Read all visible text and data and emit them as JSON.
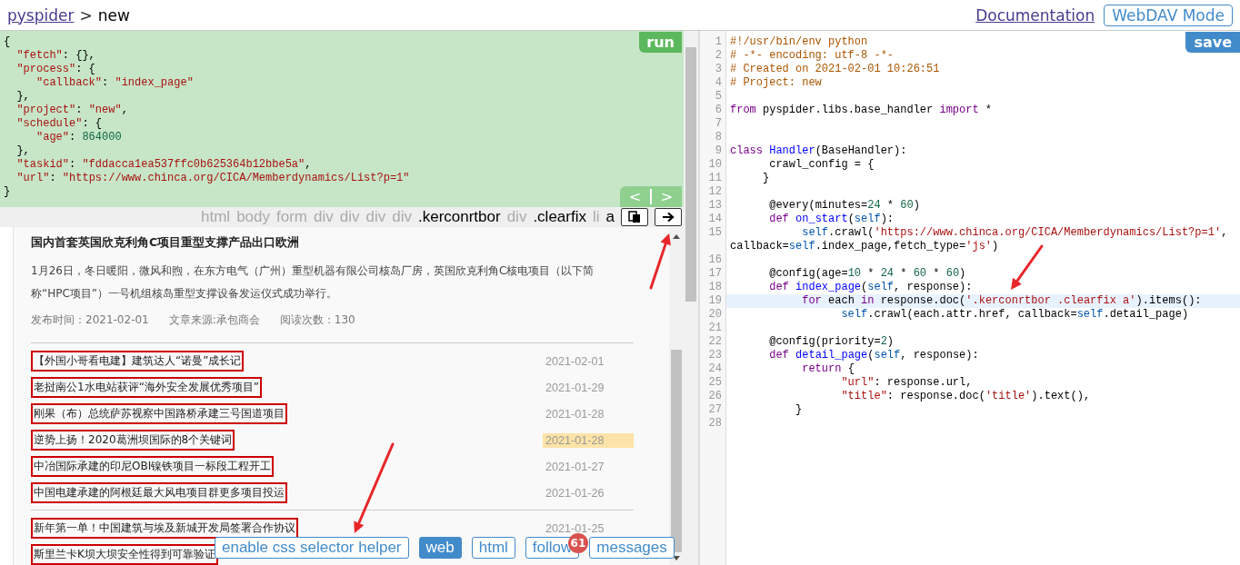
{
  "header": {
    "project_link": "pyspider",
    "separator": ">",
    "project": "new",
    "documentation_link": "Documentation",
    "webdav_button": "WebDAV Mode"
  },
  "task": {
    "run_button": "run",
    "nav_buttons": [
      "<",
      ">"
    ],
    "lines": [
      [
        {
          "kind": "plain",
          "text": "{"
        }
      ],
      [
        {
          "kind": "string",
          "text": "  \"fetch\""
        },
        {
          "kind": "plain",
          "text": ": {},"
        }
      ],
      [
        {
          "kind": "string",
          "text": "  \"process\""
        },
        {
          "kind": "plain",
          "text": ": {"
        }
      ],
      [
        {
          "kind": "string",
          "text": "     \"callback\""
        },
        {
          "kind": "plain",
          "text": ": "
        },
        {
          "kind": "string",
          "text": "\"index_page\""
        }
      ],
      [
        {
          "kind": "plain",
          "text": "  },"
        }
      ],
      [
        {
          "kind": "string",
          "text": "  \"project\""
        },
        {
          "kind": "plain",
          "text": ": "
        },
        {
          "kind": "string",
          "text": "\"new\""
        },
        {
          "kind": "plain",
          "text": ","
        }
      ],
      [
        {
          "kind": "string",
          "text": "  \"schedule\""
        },
        {
          "kind": "plain",
          "text": ": {"
        }
      ],
      [
        {
          "kind": "string",
          "text": "     \"age\""
        },
        {
          "kind": "plain",
          "text": ": "
        },
        {
          "kind": "number",
          "text": "864000"
        }
      ],
      [
        {
          "kind": "plain",
          "text": "  },"
        }
      ],
      [
        {
          "kind": "string",
          "text": "  \"taskid\""
        },
        {
          "kind": "plain",
          "text": ": "
        },
        {
          "kind": "string",
          "text": "\"fddacca1ea537ffc0b625364b12bbe5a\""
        },
        {
          "kind": "plain",
          "text": ","
        }
      ],
      [
        {
          "kind": "string",
          "text": "  \"url\""
        },
        {
          "kind": "plain",
          "text": ": "
        },
        {
          "kind": "string",
          "text": "\"https://www.chinca.org/CICA/Memberdynamics/List?p=1\""
        }
      ],
      [
        {
          "kind": "plain",
          "text": "}"
        }
      ]
    ]
  },
  "css_path": {
    "items": [
      {
        "text": "html",
        "selected": false
      },
      {
        "text": "body",
        "selected": false
      },
      {
        "text": "form",
        "selected": false
      },
      {
        "text": "div",
        "selected": false
      },
      {
        "text": "div",
        "selected": false
      },
      {
        "text": "div",
        "selected": false
      },
      {
        "text": "div",
        "selected": false
      },
      {
        "text": ".kerconrtbor",
        "selected": true
      },
      {
        "text": "div",
        "selected": false
      },
      {
        "text": ".clearfix",
        "selected": true
      },
      {
        "text": "li",
        "selected": false
      },
      {
        "text": "a",
        "selected": true
      }
    ],
    "arrow_button": {
      "annotated": true
    }
  },
  "preview": {
    "article": {
      "title": "国内首套英国欣克利角C项目重型支撑产品出口欧洲",
      "summary": "1月26日，冬日暖阳，微风和煦，在东方电气（广州）重型机器有限公司核岛厂房，英国欣克利角C核电项目（以下简称“HPC项目”）一号机组核岛重型支撑设备发运仪式成功举行。",
      "meta": [
        "发布时间：2021-02-01",
        "文章来源:承包商会",
        "阅读次数：130"
      ]
    },
    "news_groups": [
      [
        {
          "title": "【外国小哥看电建】建筑达人“诺曼”成长记",
          "date": "2021-02-01",
          "selected": true,
          "highlighted": false
        },
        {
          "title": "老挝南公1水电站获评“海外安全发展优秀项目”",
          "date": "2021-01-29",
          "selected": true,
          "highlighted": false
        },
        {
          "title": "刚果（布）总统萨苏视察中国路桥承建三号国道项目",
          "date": "2021-01-28",
          "selected": true,
          "highlighted": false
        },
        {
          "title": "逆势上扬！2020葛洲坝国际的8个关键词",
          "date": "2021-01-28",
          "selected": true,
          "highlighted": true
        },
        {
          "title": "中冶国际承建的印尼OBI镍铁项目一标段工程开工",
          "date": "2021-01-27",
          "selected": true,
          "highlighted": false
        },
        {
          "title": "中国电建承建的阿根廷最大风电项目群更多项目投运",
          "date": "2021-01-26",
          "selected": true,
          "highlighted": false
        }
      ],
      [
        {
          "title": "新年第一单！中国建筑与埃及新城开发局签署合作协议",
          "date": "2021-01-25",
          "selected": true,
          "highlighted": false
        },
        {
          "title": "斯里兰卡K坝大坝安全性得到可靠验证",
          "selected": true
        }
      ]
    ],
    "helper_button": {
      "label": "enable css selector helper",
      "annotated": true
    },
    "tabs": [
      {
        "label": "web",
        "selected": true
      },
      {
        "label": "html",
        "selected": false
      },
      {
        "label": "follow",
        "selected": false,
        "badge": "61"
      },
      {
        "label": "messages",
        "selected": false
      }
    ]
  },
  "editor": {
    "save_button": "save",
    "lines": [
      {
        "number": "1",
        "tokens": [
          {
            "kind": "comment",
            "text": "#!/usr/bin/env python"
          }
        ]
      },
      {
        "number": "2",
        "tokens": [
          {
            "kind": "comment",
            "text": "# -*- encoding: utf-8 -*-"
          }
        ]
      },
      {
        "number": "3",
        "tokens": [
          {
            "kind": "comment",
            "text": "# Created on 2021-02-01 10:26:51"
          }
        ]
      },
      {
        "number": "4",
        "tokens": [
          {
            "kind": "comment",
            "text": "# Project: new"
          }
        ]
      },
      {
        "number": "5"
      },
      {
        "number": "6",
        "tokens": [
          {
            "kind": "keyword",
            "text": "from"
          },
          {
            "kind": "plain",
            "text": " pyspider.libs.base_handler "
          },
          {
            "kind": "keyword",
            "text": "import"
          },
          {
            "kind": "plain",
            "text": " *"
          }
        ]
      },
      {
        "number": "7"
      },
      {
        "number": "8"
      },
      {
        "number": "9",
        "tokens": [
          {
            "kind": "keyword",
            "text": "class"
          },
          {
            "kind": "definition",
            "text": " Handler"
          },
          {
            "kind": "plain",
            "text": "(BaseHandler):"
          }
        ]
      },
      {
        "number": "10",
        "tokens": [
          {
            "kind": "plain",
            "text": "      crawl_config = {"
          }
        ]
      },
      {
        "number": "11",
        "tokens": [
          {
            "kind": "plain",
            "text": "     }"
          }
        ]
      },
      {
        "number": "12"
      },
      {
        "number": "13",
        "tokens": [
          {
            "kind": "plain",
            "text": "      @every(minutes="
          },
          {
            "kind": "number",
            "text": "24"
          },
          {
            "kind": "plain",
            "text": " * "
          },
          {
            "kind": "number",
            "text": "60"
          },
          {
            "kind": "plain",
            "text": ")"
          }
        ]
      },
      {
        "number": "14",
        "tokens": [
          {
            "kind": "keyword",
            "text": "      def"
          },
          {
            "kind": "definition",
            "text": " on_start"
          },
          {
            "kind": "plain",
            "text": "("
          },
          {
            "kind": "variable",
            "text": "self"
          },
          {
            "kind": "plain",
            "text": "):"
          }
        ]
      },
      {
        "number": "15",
        "tokens": [
          {
            "kind": "variable",
            "text": "           self"
          },
          {
            "kind": "plain",
            "text": ".crawl("
          },
          {
            "kind": "string",
            "text": "'https://www.chinca.org/CICA/Memberdynamics/List?p=1'"
          },
          {
            "kind": "plain",
            "text": ", callback="
          },
          {
            "kind": "variable",
            "text": "self"
          },
          {
            "kind": "plain",
            "text": ".index_page,fetch_type="
          },
          {
            "kind": "string",
            "text": "'js'"
          },
          {
            "kind": "plain",
            "text": ")"
          }
        ]
      },
      {
        "number": "16"
      },
      {
        "number": "17",
        "tokens": [
          {
            "kind": "plain",
            "text": "      @config(age="
          },
          {
            "kind": "number",
            "text": "10"
          },
          {
            "kind": "plain",
            "text": " * "
          },
          {
            "kind": "number",
            "text": "24"
          },
          {
            "kind": "plain",
            "text": " * "
          },
          {
            "kind": "number",
            "text": "60"
          },
          {
            "kind": "plain",
            "text": " * "
          },
          {
            "kind": "number",
            "text": "60"
          },
          {
            "kind": "plain",
            "text": ")"
          }
        ]
      },
      {
        "number": "18",
        "tokens": [
          {
            "kind": "keyword",
            "text": "      def"
          },
          {
            "kind": "definition",
            "text": " index_page"
          },
          {
            "kind": "plain",
            "text": "("
          },
          {
            "kind": "variable",
            "text": "self"
          },
          {
            "kind": "plain",
            "text": ", response):"
          }
        ]
      },
      {
        "number": "19",
        "active": true,
        "annotated": true,
        "tokens": [
          {
            "kind": "keyword",
            "text": "           for"
          },
          {
            "kind": "plain",
            "text": " each "
          },
          {
            "kind": "keyword",
            "text": "in"
          },
          {
            "kind": "plain",
            "text": " response.doc("
          },
          {
            "kind": "string",
            "text": "'.kerconrtbor .clearfix a'"
          },
          {
            "kind": "plain",
            "text": ").items():"
          }
        ]
      },
      {
        "number": "20",
        "tokens": [
          {
            "kind": "variable",
            "text": "                 self"
          },
          {
            "kind": "plain",
            "text": ".crawl(each.attr.href, callback="
          },
          {
            "kind": "variable",
            "text": "self"
          },
          {
            "kind": "plain",
            "text": ".detail_page)"
          }
        ]
      },
      {
        "number": "21"
      },
      {
        "number": "22",
        "tokens": [
          {
            "kind": "plain",
            "text": "      @config(priority="
          },
          {
            "kind": "number",
            "text": "2"
          },
          {
            "kind": "plain",
            "text": ")"
          }
        ]
      },
      {
        "number": "23",
        "tokens": [
          {
            "kind": "keyword",
            "text": "      def"
          },
          {
            "kind": "definition",
            "text": " detail_page"
          },
          {
            "kind": "plain",
            "text": "("
          },
          {
            "kind": "variable",
            "text": "self"
          },
          {
            "kind": "plain",
            "text": ", response):"
          }
        ]
      },
      {
        "number": "24",
        "tokens": [
          {
            "kind": "keyword",
            "text": "           return"
          },
          {
            "kind": "plain",
            "text": " {"
          }
        ]
      },
      {
        "number": "25",
        "tokens": [
          {
            "kind": "string",
            "text": "                 \"url\""
          },
          {
            "kind": "plain",
            "text": ": response.url,"
          }
        ]
      },
      {
        "number": "26",
        "tokens": [
          {
            "kind": "string",
            "text": "                 \"title\""
          },
          {
            "kind": "plain",
            "text": ": response.doc("
          },
          {
            "kind": "string",
            "text": "'title'"
          },
          {
            "kind": "plain",
            "text": ").text(),"
          }
        ]
      },
      {
        "number": "27",
        "tokens": [
          {
            "kind": "plain",
            "text": "          }"
          }
        ]
      },
      {
        "number": "28"
      }
    ]
  }
}
